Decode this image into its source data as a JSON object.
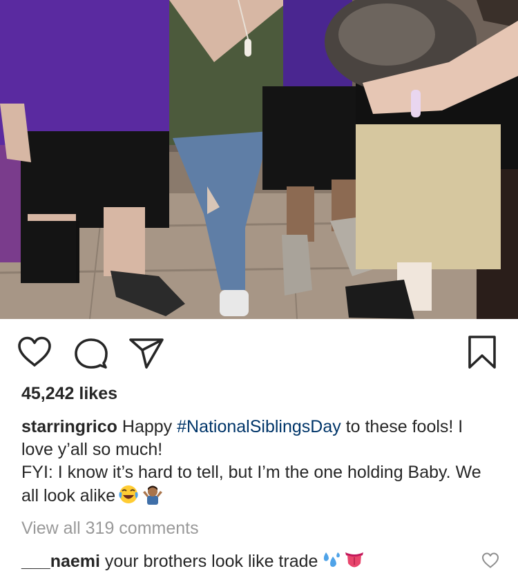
{
  "post": {
    "photo_alt": "",
    "likes_text": "45,242 likes",
    "caption": {
      "username": "starringrico",
      "text_before": "Happy ",
      "hashtag": "#NationalSiblingsDay",
      "text_after": " to these fools! I love y’all so much!",
      "line2": "FYI: I know it’s hard to tell, but I’m the one holding Baby. We all look alike",
      "emojis": [
        "face-with-tears-of-joy",
        "person-shrugging"
      ]
    },
    "view_all_comments": "View all 319 comments",
    "comment": {
      "username": "___naemi",
      "text": "your brothers look like trade",
      "emojis": [
        "sweat-droplets",
        "tongue"
      ]
    }
  },
  "icons": {
    "like": "heart-icon",
    "comment": "comment-bubble-icon",
    "share": "paper-plane-icon",
    "save": "bookmark-icon",
    "comment_like": "heart-icon"
  },
  "colors": {
    "text": "#262626",
    "hashtag": "#003569",
    "muted": "#999999",
    "background": "#ffffff"
  }
}
